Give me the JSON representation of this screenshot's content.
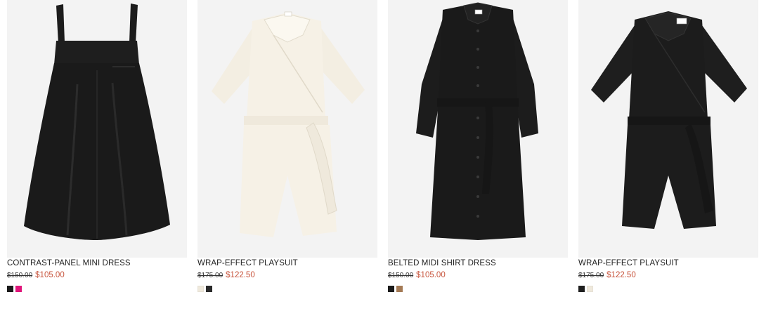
{
  "products": [
    {
      "title": "CONTRAST-PANEL MINI DRESS",
      "price_old": "$150.00",
      "price_new": "$105.00",
      "swatches": [
        "#1a1a1a",
        "#e0157a"
      ]
    },
    {
      "title": "WRAP-EFFECT PLAYSUIT",
      "price_old": "$175.00",
      "price_new": "$122.50",
      "swatches": [
        "#efe9dc",
        "#2a2a2a"
      ]
    },
    {
      "title": "BELTED MIDI SHIRT DRESS",
      "price_old": "$150.00",
      "price_new": "$105.00",
      "swatches": [
        "#1a1a1a",
        "#a47a55"
      ]
    },
    {
      "title": "WRAP-EFFECT PLAYSUIT",
      "price_old": "$175.00",
      "price_new": "$122.50",
      "swatches": [
        "#1f1f1f",
        "#efe9dc"
      ]
    }
  ],
  "colors": {
    "sale_price": "#c7533b",
    "image_background": "#f3f3f3",
    "garment_black": "#1c1c1c",
    "garment_cream": "#f4efe4"
  }
}
